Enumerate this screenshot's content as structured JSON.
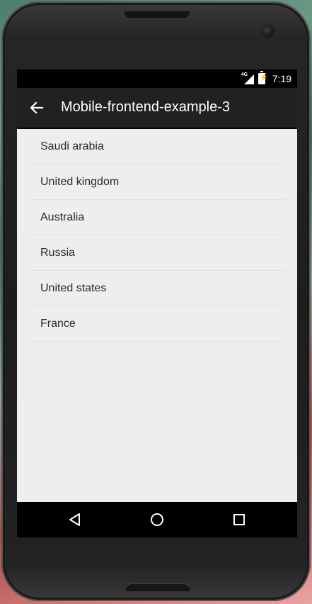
{
  "status_bar": {
    "network": "4G",
    "time": "7:19"
  },
  "app_bar": {
    "title": "Mobile-frontend-example-3",
    "back_icon": "arrow-left-icon"
  },
  "list": {
    "items": [
      {
        "label": "Saudi arabia"
      },
      {
        "label": "United kingdom"
      },
      {
        "label": "Australia"
      },
      {
        "label": "Russia"
      },
      {
        "label": "United states"
      },
      {
        "label": "France"
      }
    ]
  },
  "nav_bar": {
    "back_icon": "triangle-back-icon",
    "home_icon": "circle-home-icon",
    "recents_icon": "square-recents-icon"
  },
  "colors": {
    "app_bar": "#212121",
    "content_bg": "#eeeeee",
    "list_text": "#2a2a2a",
    "divider": "#e1e1e1"
  }
}
